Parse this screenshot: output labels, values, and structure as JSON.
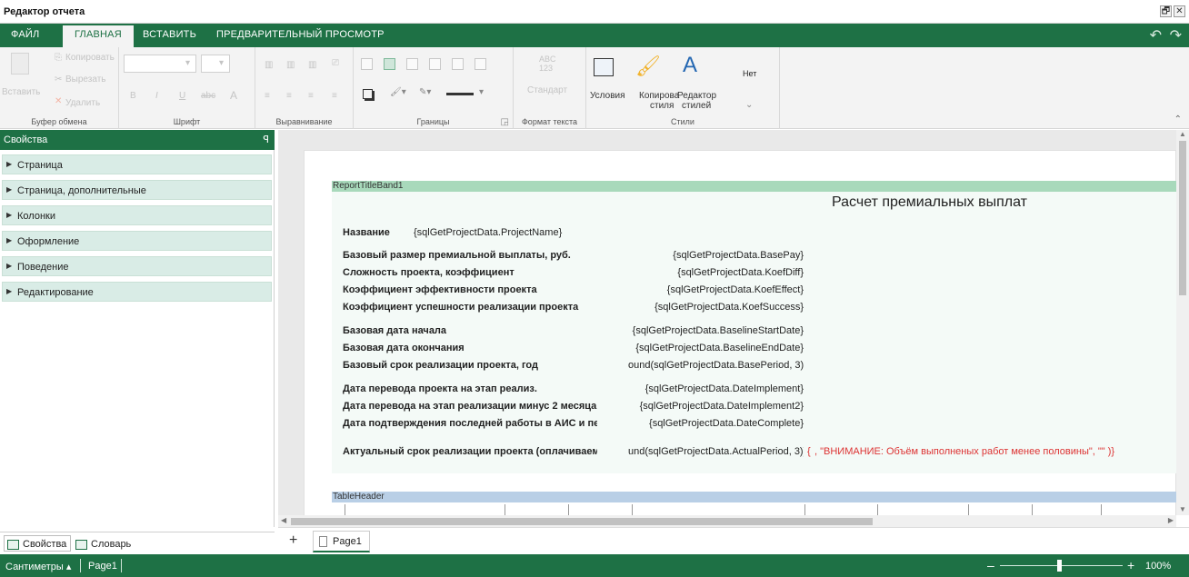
{
  "window": {
    "title": "Редактор отчета",
    "restore_label": "🗗",
    "close_label": "✕"
  },
  "tabs": [
    {
      "label": "ФАЙЛ"
    },
    {
      "label": "ГЛАВНАЯ"
    },
    {
      "label": "ВСТАВИТЬ"
    },
    {
      "label": "ПРЕДВАРИТЕЛЬНЫЙ ПРОСМОТР"
    }
  ],
  "active_tab": "ГЛАВНАЯ",
  "ribbon": {
    "clipboard": {
      "paste": "Вставить",
      "copy": "Копировать",
      "cut": "Вырезать",
      "delete": "Удалить",
      "group": "Буфер обмена"
    },
    "font": {
      "group": "Шрифт",
      "bold": "B",
      "italic": "I",
      "underline": "U",
      "strike": "abc"
    },
    "align": {
      "group": "Выравнивание"
    },
    "borders": {
      "group": "Границы"
    },
    "text_format": {
      "sample": "ABC",
      "sample_num": "123",
      "standard": "Стандарт",
      "group": "Формат текста"
    },
    "styles": {
      "conditions": "Условия",
      "copy_style_1": "Копирова",
      "copy_style_2": "стиля",
      "style_editor_1": "Редактор",
      "style_editor_2": "стилей",
      "none": "Нет",
      "group": "Стили"
    }
  },
  "properties_panel": {
    "title": "Свойства",
    "pin": "ꟼ",
    "categories": [
      {
        "label": "Страница"
      },
      {
        "label": "Страница, дополнительные"
      },
      {
        "label": "Колонки"
      },
      {
        "label": "Оформление"
      },
      {
        "label": "Поведение"
      },
      {
        "label": "Редактирование"
      }
    ],
    "bottom_tabs": [
      {
        "label": "Свойства"
      },
      {
        "label": "Словарь"
      }
    ]
  },
  "report": {
    "title_band": "ReportTitleBand1",
    "title": "Расчет премиальных выплат",
    "name_label": "Название",
    "name_value": "{sqlGetProjectData.ProjectName}",
    "rows": [
      {
        "label": "Базовый размер премиальной выплаты, руб.",
        "value": "{sqlGetProjectData.BasePay}"
      },
      {
        "label": "Сложность проекта, коэффициент",
        "value": "{sqlGetProjectData.KoefDiff}"
      },
      {
        "label": "Коэффициент эффективности проекта",
        "value": "{sqlGetProjectData.KoefEffect}"
      },
      {
        "label": "Коэффициент успешности реализации проекта",
        "value": "{sqlGetProjectData.KoefSuccess}"
      },
      {
        "label": "Базовая дата начала",
        "value": "{sqlGetProjectData.BaselineStartDate}"
      },
      {
        "label": "Базовая дата окончания",
        "value": "{sqlGetProjectData.BaselineEndDate}"
      },
      {
        "label": "Базовый срок реализации проекта, год",
        "value": "ound(sqlGetProjectData.BasePeriod, 3)}"
      },
      {
        "label": "Дата перевода проекта на этап реализ.",
        "value": "{sqlGetProjectData.DateImplement}"
      },
      {
        "label": "Дата перевода на этап реализации минус 2 месяца",
        "value": "{sqlGetProjectData.DateImplement2}"
      },
      {
        "label": "Дата подтверждения последней работы в АИС и пер",
        "value": "{sqlGetProjectData.DateComplete}"
      },
      {
        "label": "Актуальный срок реализации проекта (оплачиваемь",
        "value": "und(sqlGetProjectData.ActualPeriod, 3)}"
      }
    ],
    "warning_prefix": "{",
    "warning": ", \"ВНИМАНИЕ: Объём выполненых работ менее половины\", \"\" )}",
    "table_band": "TableHeader"
  },
  "pages": {
    "add": "+",
    "tab": "Page1"
  },
  "status": {
    "units": "Сантиметры ▴",
    "page": "Page1",
    "zoom": "100%",
    "zoom_minus": "–",
    "zoom_plus": "+"
  },
  "colors": {
    "accent": "#1e7145",
    "band_green": "#a8d9bb",
    "band_blue": "#b9cfe6",
    "warning": "#d33333"
  }
}
